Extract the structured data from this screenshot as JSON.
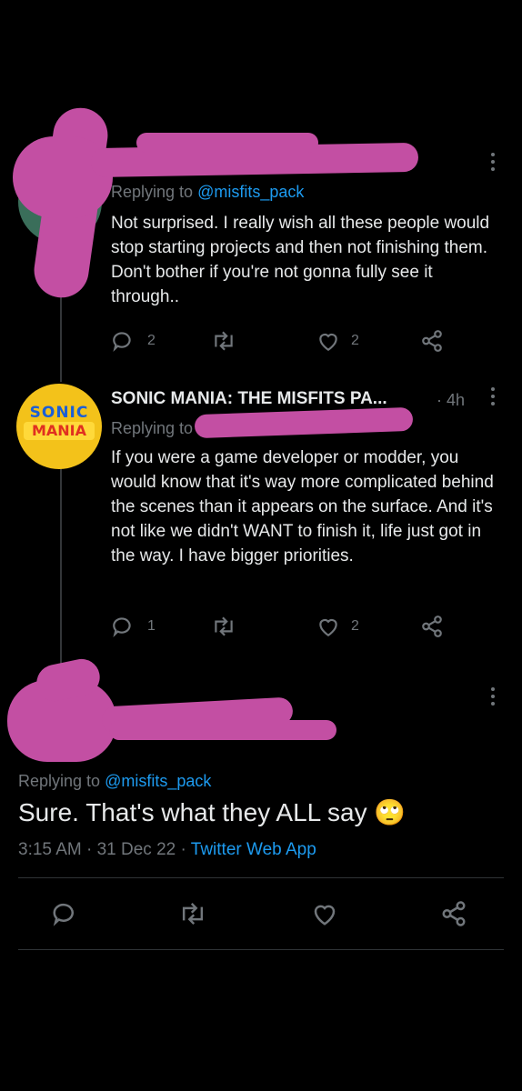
{
  "tweet1": {
    "replying_prefix": "Replying to",
    "replying_handle": "@misfits_pack",
    "text": "Not surprised. I really wish all these people would stop starting projects and then not finishing them. Don't bother if you're not gonna fully see it through..",
    "reply_count": "2",
    "like_count": "2"
  },
  "tweet2": {
    "author": "SONIC MANIA: THE MISFITS PA...",
    "time": "· 4h",
    "replying_prefix": "Replying to",
    "avatar_logo_line1": "SONIC",
    "avatar_logo_line2": "MANIA",
    "text": "If you were a game developer or modder, you would know that it's way more complicated behind the scenes than it appears on the surface. And it's not like we didn't WANT to finish it, life just got in the way. I have bigger priorities.",
    "reply_count": "1",
    "like_count": "2"
  },
  "main_tweet": {
    "replying_prefix": "Replying to",
    "replying_handle": "@misfits_pack",
    "text": "Sure. That's what they ALL say",
    "emoji": "🙄",
    "time": "3:15 AM",
    "date": "31 Dec 22",
    "source": "Twitter Web App",
    "separator": "·"
  },
  "colors": {
    "background": "#000000",
    "text": "#e7e9ea",
    "secondary": "#71767b",
    "link": "#1d9bf0",
    "redaction": "#c34fa3"
  }
}
